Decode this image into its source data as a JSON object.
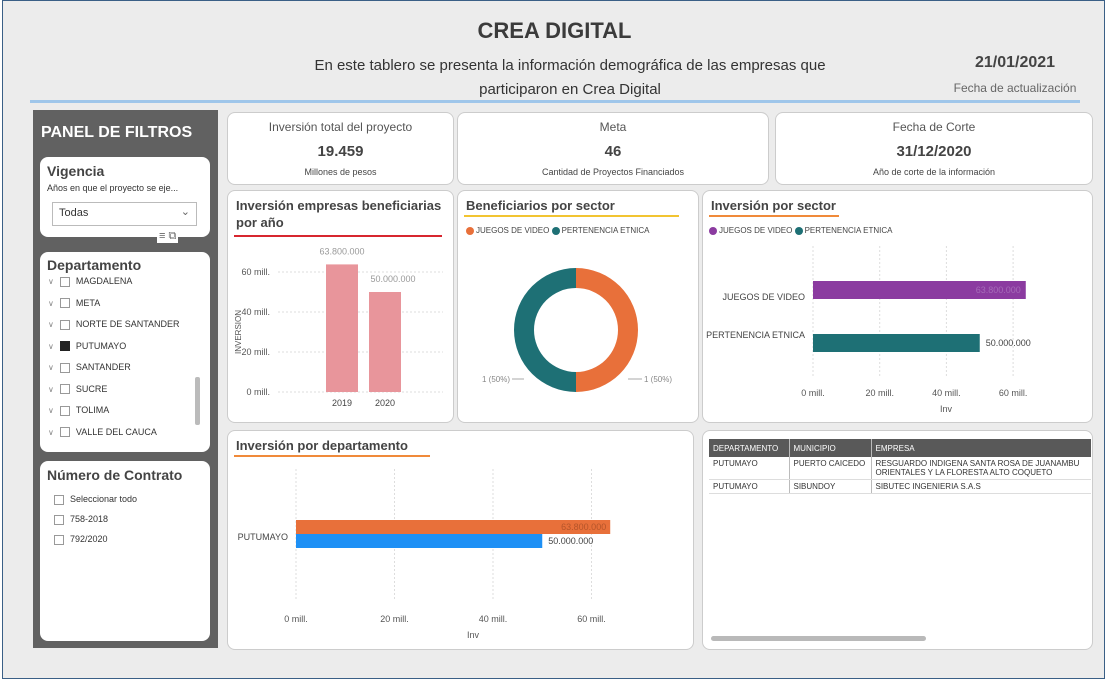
{
  "header": {
    "title": "CREA DIGITAL",
    "subtitle_line1": "En este tablero se presenta la información demográfica de las empresas que",
    "subtitle_line2": "participaron en Crea Digital",
    "update_date": "21/01/2021",
    "update_caption": "Fecha de actualización"
  },
  "filters": {
    "panel_title": "PANEL DE FILTROS",
    "vigencia": {
      "title": "Vigencia",
      "caption": "Años en que el proyecto se eje...",
      "selected": "Todas"
    },
    "departamento": {
      "title": "Departamento",
      "items": [
        {
          "label": "MAGDALENA",
          "checked": false
        },
        {
          "label": "META",
          "checked": false
        },
        {
          "label": "NORTE DE SANTANDER",
          "checked": false
        },
        {
          "label": "PUTUMAYO",
          "checked": true
        },
        {
          "label": "SANTANDER",
          "checked": false
        },
        {
          "label": "SUCRE",
          "checked": false
        },
        {
          "label": "TOLIMA",
          "checked": false
        },
        {
          "label": "VALLE DEL CAUCA",
          "checked": false
        }
      ]
    },
    "contrato": {
      "title": "Número de Contrato",
      "items": [
        "Seleccionar todo",
        "758-2018",
        "792/2020"
      ]
    }
  },
  "kpis": [
    {
      "label": "Inversión total del proyecto",
      "value": "19.459",
      "sub": "Millones de pesos"
    },
    {
      "label": "Meta",
      "value": "46",
      "sub": "Cantidad de Proyectos Financiados"
    },
    {
      "label": "Fecha de Corte",
      "value": "31/12/2020",
      "sub": "Año de corte de la información"
    }
  ],
  "colors": {
    "orange": "#e8703a",
    "teal": "#1e7075",
    "purple": "#8b3ba0",
    "pink": "#e8959b",
    "blue": "#1e90f5",
    "red_line": "#d7262f",
    "yellow_line": "#f2c431"
  },
  "chart_data": [
    {
      "type": "bar",
      "title_line1": "Inversión empresas beneficiarias",
      "title_line2": "por año",
      "ylabel": "INVERSION",
      "categories": [
        "2019",
        "2020"
      ],
      "values": [
        63800000,
        50000000
      ],
      "value_labels": [
        "63.800.000",
        "50.000.000"
      ],
      "yticks": [
        "0 mill.",
        "20 mill.",
        "40 mill.",
        "60 mill."
      ],
      "ylim": [
        0,
        70000000
      ]
    },
    {
      "type": "pie",
      "title": "Beneficiarios por sector",
      "legend": [
        "JUEGOS DE VIDEO",
        "PERTENENCIA ETNICA"
      ],
      "values": [
        1,
        1
      ],
      "labels": [
        "1 (50%)",
        "1 (50%)"
      ]
    },
    {
      "type": "bar",
      "orientation": "horizontal",
      "title": "Inversión por sector",
      "legend": [
        "JUEGOS DE VIDEO",
        "PERTENENCIA ETNICA"
      ],
      "categories": [
        "JUEGOS DE VIDEO",
        "PERTENENCIA ETNICA"
      ],
      "values": [
        63800000,
        50000000
      ],
      "value_labels": [
        "63.800.000",
        "50.000.000"
      ],
      "xticks": [
        "0 mill.",
        "20 mill.",
        "40 mill.",
        "60 mill."
      ],
      "xlabel": "Inv",
      "xlim": [
        0,
        70000000
      ]
    },
    {
      "type": "bar",
      "orientation": "horizontal",
      "title": "Inversión por departamento",
      "categories": [
        "PUTUMAYO"
      ],
      "series": [
        {
          "values": [
            63800000
          ]
        },
        {
          "values": [
            50000000
          ]
        }
      ],
      "value_labels": [
        "63.800.000",
        "50.000.000"
      ],
      "xticks": [
        "0 mill.",
        "20 mill.",
        "40 mill.",
        "60 mill."
      ],
      "xlabel": "Inv",
      "xlim": [
        0,
        70000000
      ]
    }
  ],
  "table": {
    "columns": [
      "DEPARTAMENTO",
      "MUNICIPIO",
      "EMPRESA"
    ],
    "rows": [
      {
        "dep": "PUTUMAYO",
        "mun": "PUERTO CAICEDO",
        "emp1": "RESGUARDO INDIGENA SANTA ROSA DE JUANAMBU",
        "emp2": "ORIENTALES Y LA FLORESTA ALTO COQUETO"
      },
      {
        "dep": "PUTUMAYO",
        "mun": "SIBUNDOY",
        "emp1": "SIBUTEC INGENIERIA S.A.S",
        "emp2": ""
      }
    ]
  }
}
